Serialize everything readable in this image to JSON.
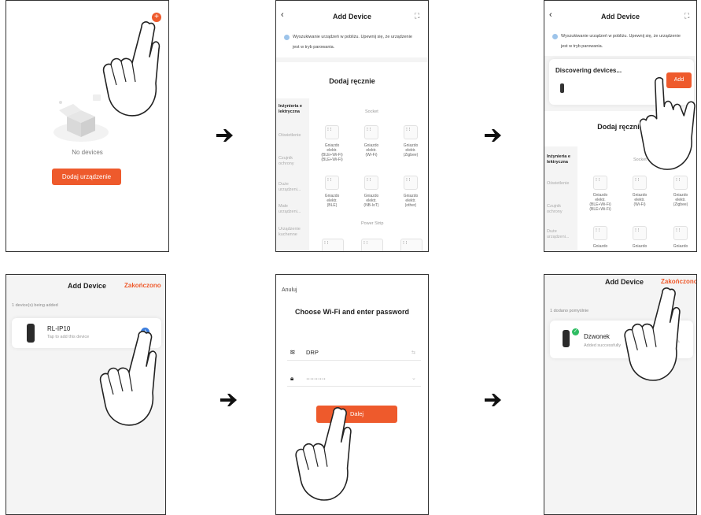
{
  "colors": {
    "accent": "#ee5a2c",
    "blue": "#3b7ddd",
    "green": "#2fbd63"
  },
  "p1": {
    "empty_label": "No devices",
    "add_button": "Dodaj urządzenie"
  },
  "p2": {
    "title": "Add Device",
    "info": "Wyszukiwanie urządzeń w pobliżu. Upewnij się, że urządzenie",
    "info2": "jest w tryb parowania.",
    "section": "Dodaj ręcznie",
    "category_active": "Inżynieria e\nlektryczna",
    "categories": [
      "Oświetlenie",
      "Czujnik\nochrony",
      "Duże\nurządzeni...",
      "Małe\nurządzeni...",
      "Urządzenie\nkuchenne"
    ],
    "group1": "Socket",
    "group2": "Power Strip",
    "row1": [
      "Gniazdo\nelektr.\n(BLE+Wi-Fi)\n(BLE+Wi-Fi)",
      "Gniazdo\nelektr.\n(Wi-Fi)",
      "Gniazdo\nelektr.\n(Zigbee)"
    ],
    "row2": [
      "Gniazdo\nelektr.\n(BLE)",
      "Gniazdo\nelektr.\n(NB-IoT)",
      "Gniazdo\nelektr.\n(other)"
    ]
  },
  "p3": {
    "title": "Add Device",
    "info": "Wyszukiwanie urządzeń w pobliżu. Upewnij się, że urządzenie",
    "info2": "jest w tryb parowania.",
    "discovering": "Discovering devices...",
    "add": "Add",
    "section": "Dodaj ręcznie",
    "category_active": "Inżynieria e\nlektryczna",
    "categories": [
      "Oświetlenie",
      "Czujnik\nochrony",
      "Duże\nurządzeni..."
    ],
    "group1": "Socket",
    "row1": [
      "Gniazdo\nelektr.\n(BLE+Wi-Fi)\n(BLE+Wi-Fi)",
      "Gniazdo\nelektr.\n(Wi-Fi)",
      "Gniazdo\nelektr.\n(Zigbee)"
    ],
    "row2": [
      "Gniazdo",
      "Gniazdo",
      "Gniazdo"
    ]
  },
  "p4": {
    "title": "Add Device",
    "done": "Zakończono",
    "count": "1 device(s) being added",
    "device": "RL-IP10",
    "device_sub": "Tap to add this device"
  },
  "p5": {
    "cancel": "Anuluj",
    "title": "Choose Wi-Fi and enter password",
    "wifi": "DRP",
    "password": "··········",
    "next": "Dalej"
  },
  "p6": {
    "title": "Add Device",
    "done": "Zakończono",
    "count": "1 dodano pomyślnie",
    "device": "Dzwonek",
    "device_sub": "Added successfully"
  }
}
